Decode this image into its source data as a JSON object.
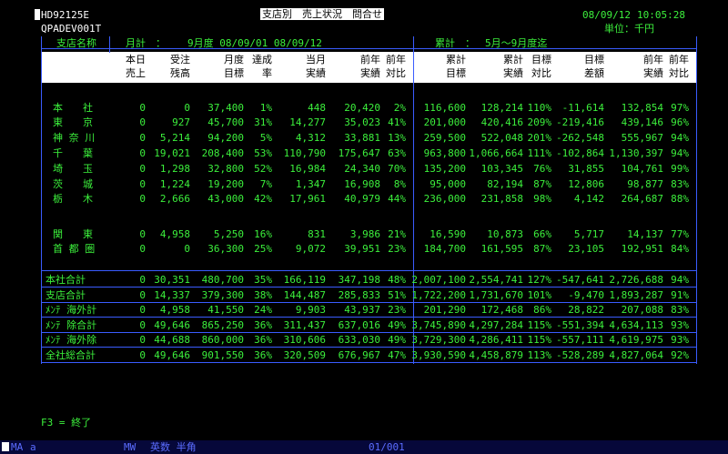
{
  "header": {
    "program_id": "HD92125E",
    "terminal_id": "QPADEV001T",
    "title": "支店別　売上状況　問合せ",
    "date": "08/09/12",
    "time": "10:05:28",
    "unit": "単位：千円"
  },
  "section": {
    "branch_label": "支店名称",
    "month_label": "月計　：",
    "month_period": "9月度 08/09/01 08/09/12",
    "cum_label": "累計　：",
    "cum_period": "5月～9月度迄"
  },
  "columns": {
    "today_1": "本日",
    "today_2": "売上",
    "order_1": "受注",
    "order_2": "残高",
    "month_target_1": "月度",
    "month_target_2": "目標",
    "rate_1": "達成",
    "rate_2": "率",
    "month_actual_1": "当月",
    "month_actual_2": "実績",
    "prev_1": "前年",
    "prev_2": "実績",
    "prev_ratio_1": "前年",
    "prev_ratio_2": "対比",
    "cum_target_1": "累計",
    "cum_target_2": "目標",
    "cum_actual_1": "累計",
    "cum_actual_2": "実績",
    "cum_ratio_1": "目標",
    "cum_ratio_2": "対比",
    "diff_1": "目標",
    "diff_2": "差額",
    "cum_prev_1": "前年",
    "cum_prev_2": "実績",
    "cum_prev_ratio_1": "前年",
    "cum_prev_ratio_2": "対比"
  },
  "rows": [
    {
      "name": "本　　社",
      "v": [
        "0",
        "0",
        "37,400",
        "1%",
        "448",
        "20,420",
        "2%",
        "116,600",
        "128,214",
        "110%",
        "-11,614",
        "132,854",
        "97%"
      ]
    },
    {
      "name": "東　　京",
      "v": [
        "0",
        "927",
        "45,700",
        "31%",
        "14,277",
        "35,023",
        "41%",
        "201,000",
        "420,416",
        "209%",
        "-219,416",
        "439,146",
        "96%"
      ]
    },
    {
      "name": "神 奈 川",
      "v": [
        "0",
        "5,214",
        "94,200",
        "5%",
        "4,312",
        "33,881",
        "13%",
        "259,500",
        "522,048",
        "201%",
        "-262,548",
        "555,967",
        "94%"
      ]
    },
    {
      "name": "千　　葉",
      "v": [
        "0",
        "19,021",
        "208,400",
        "53%",
        "110,790",
        "175,647",
        "63%",
        "963,800",
        "1,066,664",
        "111%",
        "-102,864",
        "1,130,397",
        "94%"
      ]
    },
    {
      "name": "埼　　玉",
      "v": [
        "0",
        "1,298",
        "32,800",
        "52%",
        "16,984",
        "24,340",
        "70%",
        "135,200",
        "103,345",
        "76%",
        "31,855",
        "104,761",
        "99%"
      ]
    },
    {
      "name": "茨　　城",
      "v": [
        "0",
        "1,224",
        "19,200",
        "7%",
        "1,347",
        "16,908",
        "8%",
        "95,000",
        "82,194",
        "87%",
        "12,806",
        "98,877",
        "83%"
      ]
    },
    {
      "name": "栃　　木",
      "v": [
        "0",
        "2,666",
        "43,000",
        "42%",
        "17,961",
        "40,979",
        "44%",
        "236,000",
        "231,858",
        "98%",
        "4,142",
        "264,687",
        "88%"
      ]
    },
    {
      "name": "関　　東",
      "v": [
        "0",
        "4,958",
        "5,250",
        "16%",
        "831",
        "3,986",
        "21%",
        "16,590",
        "10,873",
        "66%",
        "5,717",
        "14,137",
        "77%"
      ]
    },
    {
      "name": "首 都 圏",
      "v": [
        "0",
        "0",
        "36,300",
        "25%",
        "9,072",
        "39,951",
        "23%",
        "184,700",
        "161,595",
        "87%",
        "23,105",
        "192,951",
        "84%"
      ]
    }
  ],
  "totals": [
    {
      "name": "本社合計",
      "v": [
        "0",
        "30,351",
        "480,700",
        "35%",
        "166,119",
        "347,198",
        "48%",
        "2,007,100",
        "2,554,741",
        "127%",
        "-547,641",
        "2,726,688",
        "94%"
      ]
    },
    {
      "name": "支店合計",
      "v": [
        "0",
        "14,337",
        "379,300",
        "38%",
        "144,487",
        "285,833",
        "51%",
        "1,722,200",
        "1,731,670",
        "101%",
        "-9,470",
        "1,893,287",
        "91%"
      ]
    },
    {
      "name": "ﾒﾝﾃ 海外計",
      "v": [
        "0",
        "4,958",
        "41,550",
        "24%",
        "9,903",
        "43,937",
        "23%",
        "201,290",
        "172,468",
        "86%",
        "28,822",
        "207,088",
        "83%"
      ]
    },
    {
      "name": "ﾒﾝﾃ 除合計",
      "v": [
        "0",
        "49,646",
        "865,250",
        "36%",
        "311,437",
        "637,016",
        "49%",
        "3,745,890",
        "4,297,284",
        "115%",
        "-551,394",
        "4,634,113",
        "93%"
      ]
    },
    {
      "name": "ﾒﾝﾃ 海外除",
      "v": [
        "0",
        "44,688",
        "860,000",
        "36%",
        "310,606",
        "633,030",
        "49%",
        "3,729,300",
        "4,286,411",
        "115%",
        "-557,111",
        "4,619,975",
        "93%"
      ]
    },
    {
      "name": "全社総合計",
      "v": [
        "0",
        "49,646",
        "901,550",
        "36%",
        "320,509",
        "676,967",
        "47%",
        "3,930,590",
        "4,458,879",
        "113%",
        "-528,289",
        "4,827,064",
        "92%"
      ]
    }
  ],
  "footer": {
    "fkey": "F3 = 終了"
  },
  "statusbar": {
    "left1": "MA",
    "left2": "a",
    "mode1": "MW",
    "mode2": "英数 半角",
    "page": "01/001"
  },
  "colors": {
    "text": "#3cf03c",
    "lines": "#3a5cff",
    "background": "#000000"
  }
}
